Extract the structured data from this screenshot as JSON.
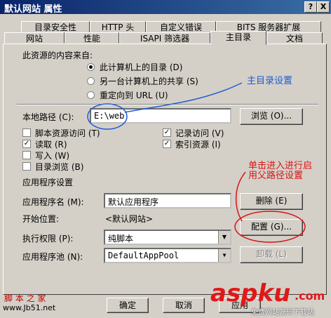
{
  "window": {
    "title": "默认网站 属性",
    "help_btn": "?",
    "close_btn": "X"
  },
  "tabs_row1": [
    "目录安全性",
    "HTTP 头",
    "自定义错误",
    "BITS 服务器扩展"
  ],
  "tabs_row2": [
    "网站",
    "性能",
    "ISAPI 筛选器",
    "主目录",
    "文档"
  ],
  "source": {
    "label": "此资源的内容来自:",
    "options": [
      "此计算机上的目录 (D)",
      "另一台计算机上的共享 (S)",
      "重定向到 URL (U)"
    ]
  },
  "local_path": {
    "label": "本地路径 (C):",
    "value": "E:\\web",
    "browse": "浏览 (O)..."
  },
  "checks": {
    "script_access": "脚本资源访问 (T)",
    "read": "读取 (R)",
    "write": "写入 (W)",
    "dir_browse": "目录浏览 (B)",
    "log_visits": "记录访问 (V)",
    "index_resource": "索引资源 (I)",
    "check_mark": "✓"
  },
  "app": {
    "section": "应用程序设置",
    "name_label": "应用程序名 (M):",
    "name_value": "默认应用程序",
    "remove": "删除 (E)",
    "start_label": "开始位置:",
    "start_value": "<默认网站>",
    "config": "配置 (G)...",
    "perm_label": "执行权限 (P):",
    "perm_value": "纯脚本",
    "pool_label": "应用程序池 (N):",
    "pool_value": "DefaultAppPool",
    "unload": "卸载 (L)"
  },
  "footer": {
    "ok": "确定",
    "cancel": "取消",
    "apply": "应用"
  },
  "annotations": {
    "blue": "主目录设置",
    "red": "单击进入进行启用父路径设置"
  },
  "watermarks": {
    "left_top": "脚 本 之 家",
    "left_bottom": "www.Jb51.net",
    "right": "aspku",
    "right_sub": ".com",
    "right_tag": "免费网站源码下载站"
  }
}
